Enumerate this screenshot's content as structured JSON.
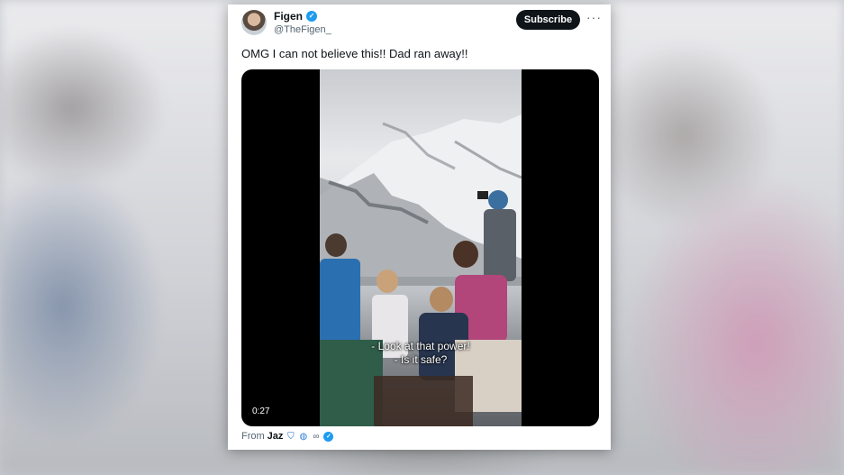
{
  "tweet": {
    "display_name": "Figen",
    "handle": "@TheFigen_",
    "subscribe_label": "Subscribe",
    "more_label": "···",
    "text": "OMG I can not believe this!! Dad ran away!!",
    "verified_mark": "✓"
  },
  "video": {
    "duration": "0:27",
    "subtitle_line1": "- Look at that power!",
    "subtitle_line2": "- Is it safe?"
  },
  "source": {
    "prefix": "From",
    "name": "Jaz",
    "icons": [
      "shield-icon",
      "globe-icon",
      "link-icon",
      "verified-icon"
    ],
    "shield_glyph": "⛉",
    "globe_glyph": "◍",
    "link_glyph": "∞",
    "check_glyph": "✓"
  },
  "colors": {
    "accent": "#1d9bf0",
    "text_primary": "#0f1419",
    "text_secondary": "#536471",
    "subscribe_bg": "#0f1419"
  }
}
